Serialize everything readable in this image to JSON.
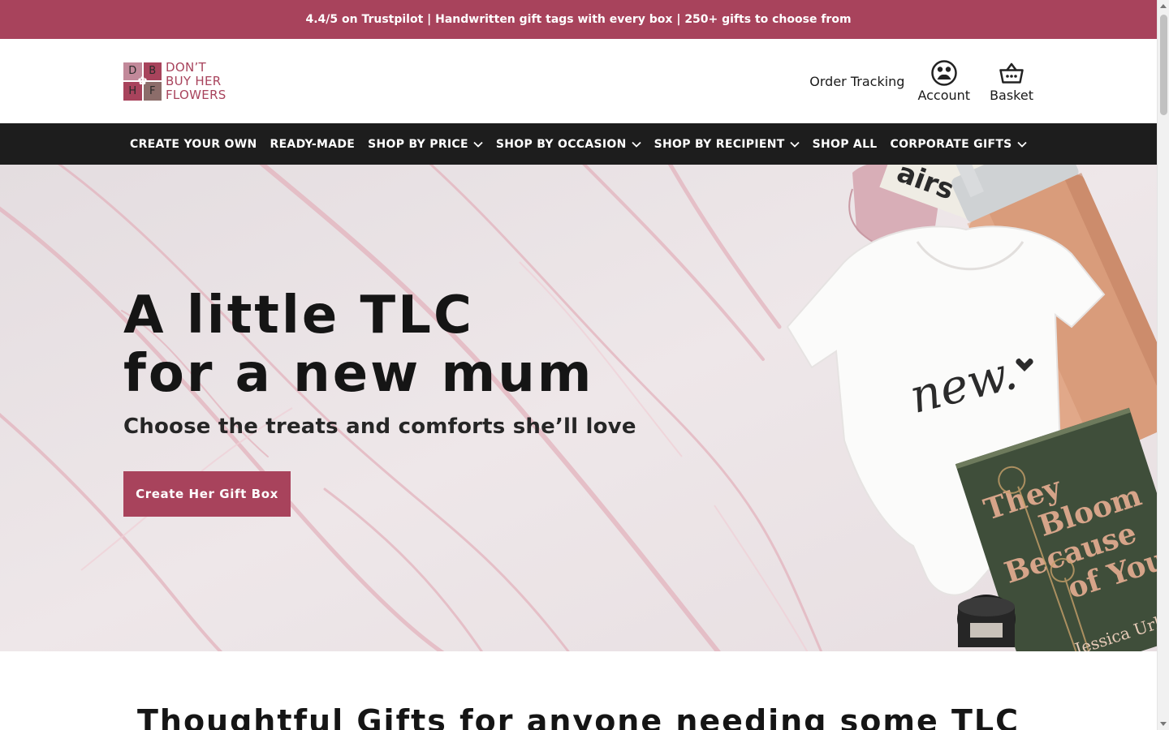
{
  "announcement": {
    "text": "4.4/5 on Trustpilot | Handwritten gift tags with every box | 250+ gifts to choose from"
  },
  "logo": {
    "letters": [
      "D",
      "B",
      "H",
      "F"
    ],
    "line1": "DON’T",
    "line2": "BUY HER",
    "line3": "FLOWERS"
  },
  "header": {
    "order_tracking": "Order Tracking",
    "account_label": "Account",
    "basket_label": "Basket",
    "icons": {
      "account": "account-icon",
      "basket": "basket-icon"
    }
  },
  "nav": {
    "items": [
      {
        "label": "CREATE YOUR OWN",
        "dropdown": false
      },
      {
        "label": "READY-MADE",
        "dropdown": false
      },
      {
        "label": "SHOP BY PRICE",
        "dropdown": true
      },
      {
        "label": "SHOP BY OCCASION",
        "dropdown": true
      },
      {
        "label": "SHOP BY RECIPIENT",
        "dropdown": true
      },
      {
        "label": "SHOP ALL",
        "dropdown": false
      },
      {
        "label": "CORPORATE GIFTS",
        "dropdown": true
      }
    ]
  },
  "hero": {
    "title_line1": "A little TLC",
    "title_line2": "for a new mum",
    "subtitle": "Choose the treats and comforts she’ll love",
    "cta": "Create Her Gift Box",
    "image_text": {
      "bodysuit": "new.",
      "book_title_1": "They",
      "book_title_2": "Bloom",
      "book_title_3": "Because",
      "book_title_4": "of You",
      "book_author": "Jessica Urlichs",
      "socks_text": "airs"
    }
  },
  "section": {
    "title": "Thoughtful Gifts for anyone needing some TLC"
  },
  "colors": {
    "brand": "#a8435c",
    "nav_bg": "#1d1d1d",
    "text": "#1a1a1a"
  }
}
